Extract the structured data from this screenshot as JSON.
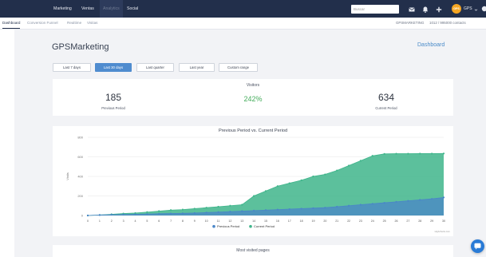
{
  "topbar": {
    "nav": [
      "Marketing",
      "Ventas",
      "Analytics",
      "Social"
    ],
    "active_nav": "Analytics",
    "search_placeholder": "Buscar",
    "user_avatar_text": "GPS",
    "user_name": "GPS"
  },
  "subnav": {
    "tabs": [
      "Dashboard",
      "Conversion Funnel",
      "Realtime",
      "Visitas"
    ],
    "active_tab": "Dashboard",
    "account": "GPSMARKETING",
    "contacts": "1012 / 995000 contacts"
  },
  "page": {
    "title": "GPSMarketing",
    "dashboard_link": "Dashboard"
  },
  "date_ranges": {
    "buttons": [
      "Last 7 days",
      "Last 30 days",
      "Last quarter",
      "Last year",
      "Custom range"
    ],
    "active": "Last 30 days"
  },
  "visitors": {
    "title": "Visitors",
    "previous_value": "185",
    "previous_label": "Previous Period",
    "growth": "242%",
    "current_value": "634",
    "current_label": "Current Period"
  },
  "most_visited": {
    "title": "Most visited pages"
  },
  "colors": {
    "topbar": "#222f4b",
    "accent": "#4f8ccf",
    "growth": "#45ad5c",
    "previous_series": "#4a86c8",
    "current_series": "#3fb58b",
    "avatar": "#f5a623",
    "chat": "#2a7bd6"
  },
  "chart_data": {
    "type": "area",
    "title": "Previous Period vs. Current Period",
    "ylabel": "Visits",
    "xlabel": "",
    "ylim": [
      0,
      800
    ],
    "yticks": [
      0,
      200,
      400,
      600,
      800
    ],
    "x": [
      "0",
      "1",
      "2",
      "3",
      "4",
      "5",
      "6",
      "7",
      "8",
      "9",
      "10",
      "11",
      "12",
      "13",
      "14",
      "15",
      "16",
      "17",
      "18",
      "19",
      "20",
      "21",
      "22",
      "23",
      "24",
      "25",
      "26",
      "27",
      "28",
      "29",
      "30"
    ],
    "series": [
      {
        "name": "Previous Period",
        "values": [
          0,
          5,
          8,
          10,
          12,
          15,
          18,
          20,
          22,
          25,
          30,
          35,
          40,
          45,
          50,
          55,
          60,
          65,
          70,
          75,
          80,
          90,
          100,
          110,
          120,
          130,
          140,
          150,
          160,
          170,
          185
        ]
      },
      {
        "name": "Current Period",
        "values": [
          0,
          5,
          12,
          20,
          25,
          35,
          45,
          55,
          60,
          70,
          80,
          90,
          100,
          110,
          200,
          250,
          300,
          330,
          360,
          400,
          420,
          460,
          510,
          560,
          610,
          630,
          632,
          632,
          633,
          633,
          634
        ]
      }
    ],
    "legend": "bottom",
    "grid": true,
    "credit": "Highcharts.com"
  }
}
